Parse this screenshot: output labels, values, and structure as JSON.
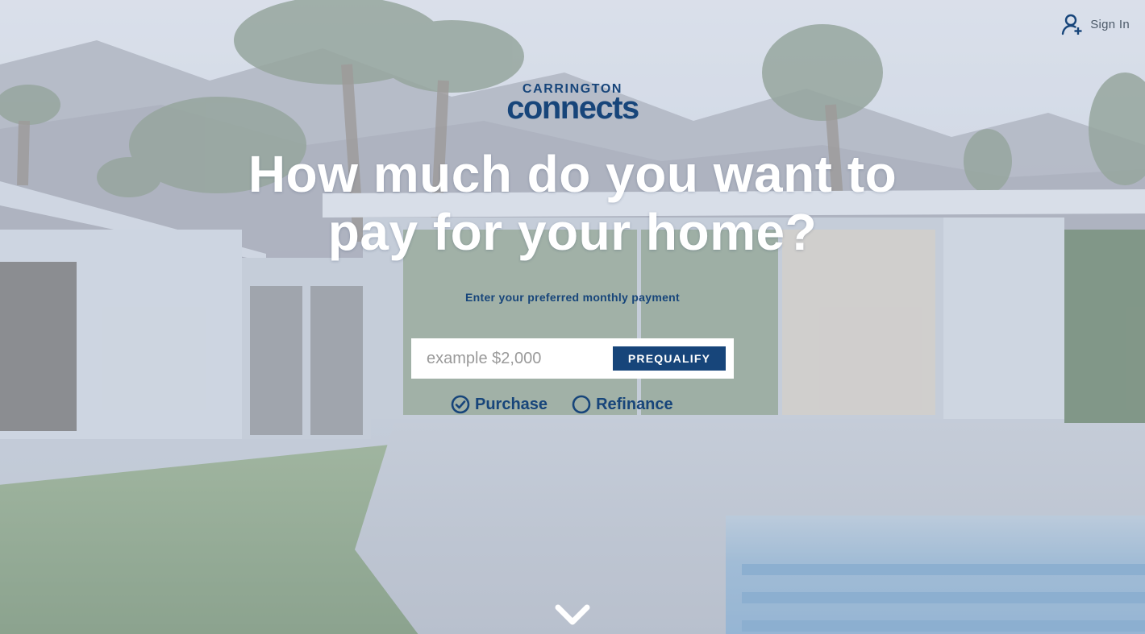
{
  "header": {
    "signin_label": "Sign In",
    "signin_icon": "user-add-icon"
  },
  "logo": {
    "top": "CARRINGTON",
    "main": "connects"
  },
  "hero": {
    "headline_line1": "How much do you want to",
    "headline_line2": "pay for your home?",
    "prompt": "Enter your preferred monthly payment"
  },
  "form": {
    "placeholder": "example $2,000",
    "value": "",
    "submit_label": "PREQUALIFY"
  },
  "options": [
    {
      "label": "Purchase",
      "checked": true,
      "icon": "check-circle-icon"
    },
    {
      "label": "Refinance",
      "checked": false,
      "icon": "circle-icon"
    }
  ],
  "scroll": {
    "icon": "chevron-down-icon"
  },
  "colors": {
    "brand": "#17457a",
    "headline": "#ffffff",
    "signin": "#4b5968"
  }
}
